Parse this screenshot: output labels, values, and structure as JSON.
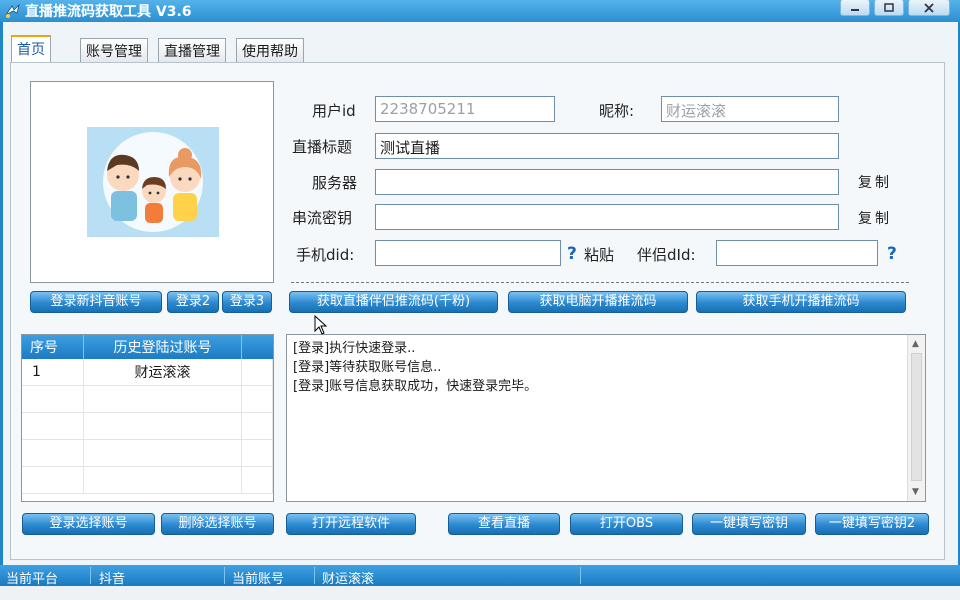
{
  "window": {
    "title": "直播推流码获取工具 V3.6"
  },
  "tabs": [
    "首页",
    "账号管理",
    "直播管理",
    "使用帮助"
  ],
  "form": {
    "user_id_label": "用户id",
    "user_id_value": "2238705211",
    "nickname_label": "昵称:",
    "nickname_value": "财运滚滚",
    "title_label": "直播标题",
    "title_value": "测试直播",
    "server_label": "服务器",
    "server_value": "",
    "key_label": "串流密钥",
    "key_value": "",
    "phone_did_label": "手机did:",
    "phone_did_value": "",
    "paste_label": "粘贴",
    "partner_did_label": "伴侣dId:",
    "partner_did_value": "",
    "copy_label": "复制"
  },
  "buttons": {
    "login_new": "登录新抖音账号",
    "login2": "登录2",
    "login3": "登录3",
    "get_partner": "获取直播伴侣推流码(千粉)",
    "get_pc": "获取电脑开播推流码",
    "get_phone": "获取手机开播推流码",
    "login_selected": "登录选择账号",
    "delete_selected": "删除选择账号",
    "open_remote": "打开远程软件",
    "view_live": "查看直播",
    "open_obs": "打开OBS",
    "fill_key": "一键填写密钥",
    "fill_key2": "一键填写密钥2"
  },
  "history_table": {
    "headers": [
      "序号",
      "历史登陆过账号"
    ],
    "rows": [
      {
        "index": "1",
        "account": "财运滚滚"
      }
    ]
  },
  "log": {
    "lines": [
      "[登录]执行快速登录..",
      "[登录]等待获取账号信息..",
      "[登录]账号信息获取成功，快速登录完毕。"
    ]
  },
  "status": {
    "platform_label": "当前平台",
    "platform_value": "抖音",
    "account_label": "当前账号",
    "account_value": "财运滚滚"
  }
}
